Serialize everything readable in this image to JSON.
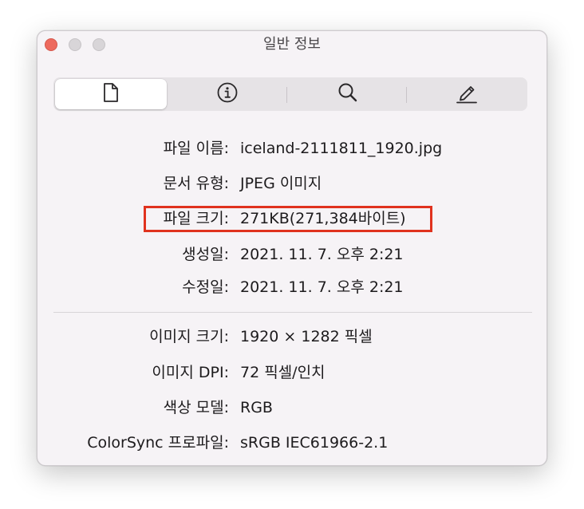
{
  "window": {
    "title": "일반 정보"
  },
  "tabs": [
    {
      "name": "document",
      "icon": "document-icon",
      "active": true
    },
    {
      "name": "info",
      "icon": "info-icon",
      "active": false
    },
    {
      "name": "search",
      "icon": "magnifier-icon",
      "active": false
    },
    {
      "name": "edit",
      "icon": "pencil-icon",
      "active": false
    }
  ],
  "file_info": {
    "name_label": "파일 이름:",
    "name_value": "iceland-2111811_1920.jpg",
    "kind_label": "문서 유형:",
    "kind_value": "JPEG 이미지",
    "size_label": "파일 크기:",
    "size_value": "271KB(271,384바이트)",
    "created_label": "생성일:",
    "created_value": "2021. 11. 7. 오후 2:21",
    "modified_label": "수정일:",
    "modified_value": "2021. 11. 7. 오후 2:21"
  },
  "image_info": {
    "dimensions_label": "이미지 크기:",
    "dimensions_value": "1920 × 1282 픽셀",
    "dpi_label": "이미지 DPI:",
    "dpi_value": "72 픽셀/인치",
    "color_model_label": "색상 모델:",
    "color_model_value": "RGB",
    "profile_label": "ColorSync 프로파일:",
    "profile_value": "sRGB IEC61966-2.1"
  },
  "colors": {
    "close_button": "#ed6a5e",
    "highlight": "#e0321e",
    "window_background": "#f6f3f6"
  }
}
